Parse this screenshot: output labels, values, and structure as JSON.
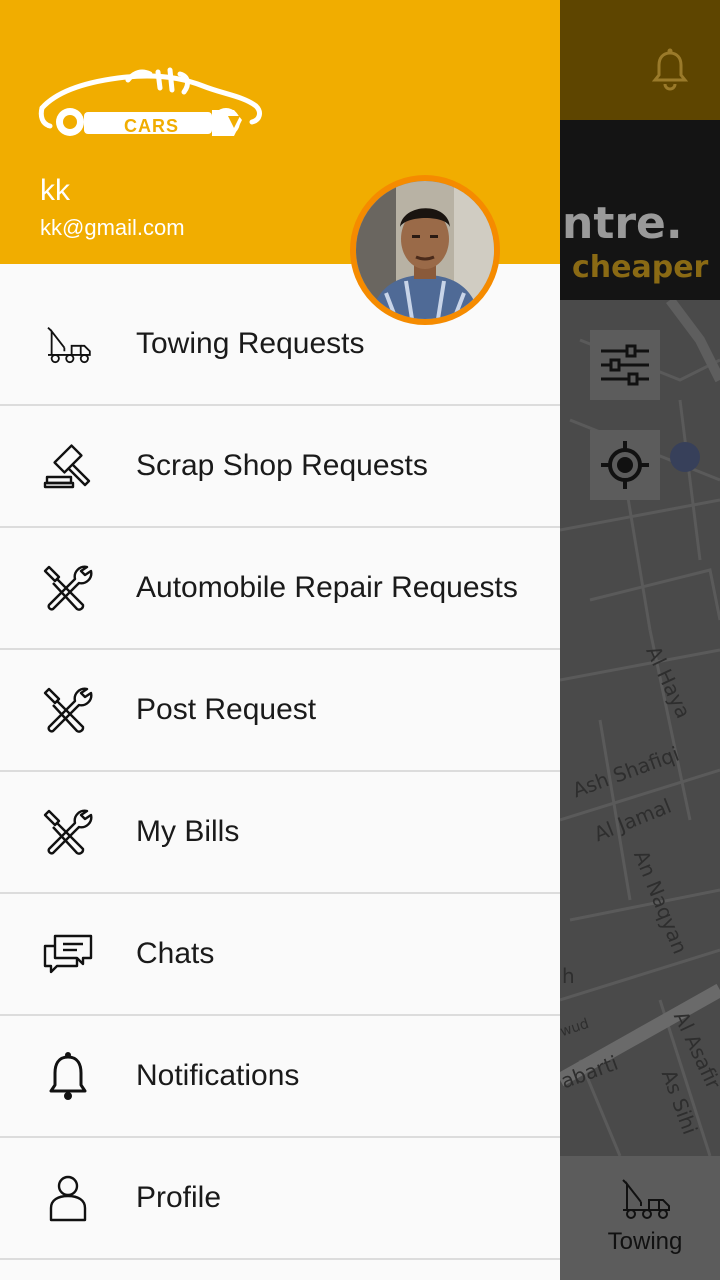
{
  "background": {
    "banner": {
      "line1": "ntre.",
      "line2": "cheaper"
    },
    "map_labels": [
      "Al Haya",
      "Ash Shafiqi",
      "Al Jamal",
      "An Naqyan",
      "Al Asafir",
      "As Sihi",
      "abarti",
      "wud",
      "h"
    ],
    "bottom_tab": {
      "label": "Towing",
      "icon": "tow-truck-icon"
    }
  },
  "drawer": {
    "logo_text": "CARS",
    "user": {
      "name": "kk",
      "email": "kk@gmail.com"
    },
    "menu": [
      {
        "label": "Towing Requests",
        "icon": "tow-truck-icon"
      },
      {
        "label": "Scrap Shop Requests",
        "icon": "gavel-icon"
      },
      {
        "label": "Automobile Repair Requests",
        "icon": "tools-icon"
      },
      {
        "label": "Post Request",
        "icon": "tools-icon"
      },
      {
        "label": "My Bills",
        "icon": "tools-icon"
      },
      {
        "label": "Chats",
        "icon": "chat-icon"
      },
      {
        "label": "Notifications",
        "icon": "bell-icon"
      },
      {
        "label": "Profile",
        "icon": "person-icon"
      }
    ]
  },
  "colors": {
    "header": "#f1ad00",
    "avatar_ring": "#f58b00",
    "drawer_bg": "#fafafa"
  }
}
